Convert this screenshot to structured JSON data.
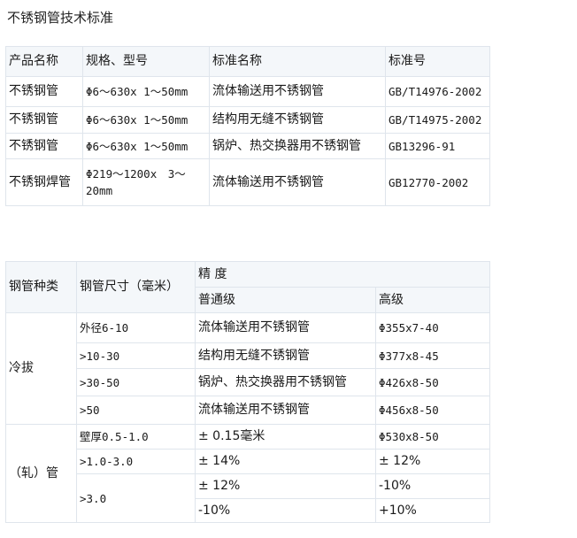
{
  "title": "不锈钢管技术标准",
  "table1": {
    "headers": [
      "产品名称",
      "规格、型号",
      "标准名称",
      "标准号"
    ],
    "rows": [
      [
        "不锈钢管",
        "Φ6～630x 1～50mm",
        "流体输送用不锈钢管",
        "GB/T14976-2002"
      ],
      [
        "不锈钢管",
        "Φ6～630x 1～50mm",
        "结构用无缝不锈钢管",
        "GB/T14975-2002"
      ],
      [
        "不锈钢管",
        "Φ6～630x 1～50mm",
        "锅炉、热交换器用不锈钢管",
        "GB13296-91"
      ],
      [
        "不锈钢焊管",
        "Φ219～1200x　3～20mm",
        "流体输送用不锈钢管",
        "GB12770-2002"
      ]
    ]
  },
  "table2": {
    "headers": {
      "type": "钢管种类",
      "size": "钢管尺寸（毫米）",
      "precision": "精 度",
      "normal": "普通级",
      "high": "高级"
    },
    "groups": {
      "cold": "冷拔",
      "rolled": "（轧）管"
    },
    "rows": [
      {
        "size": "外径6-10",
        "normal": "流体输送用不锈钢管",
        "high": "Φ355x7-40"
      },
      {
        "size": ">10-30",
        "normal": "结构用无缝不锈钢管",
        "high": "Φ377x8-45"
      },
      {
        "size": ">30-50",
        "normal": "锅炉、热交换器用不锈钢管",
        "high": "Φ426x8-50"
      },
      {
        "size": ">50",
        "normal": "流体输送用不锈钢管",
        "high": "Φ456x8-50"
      },
      {
        "size": "壁厚0.5-1.0",
        "normal": "± 0.15毫米",
        "high": "Φ530x8-50"
      },
      {
        "size": ">1.0-3.0",
        "normal": "± 14%",
        "high": "± 12%"
      },
      {
        "size": ">3.0",
        "normal": "± 12%",
        "high": "-10%"
      },
      {
        "normal": "-10%",
        "high": "+10%"
      }
    ]
  }
}
